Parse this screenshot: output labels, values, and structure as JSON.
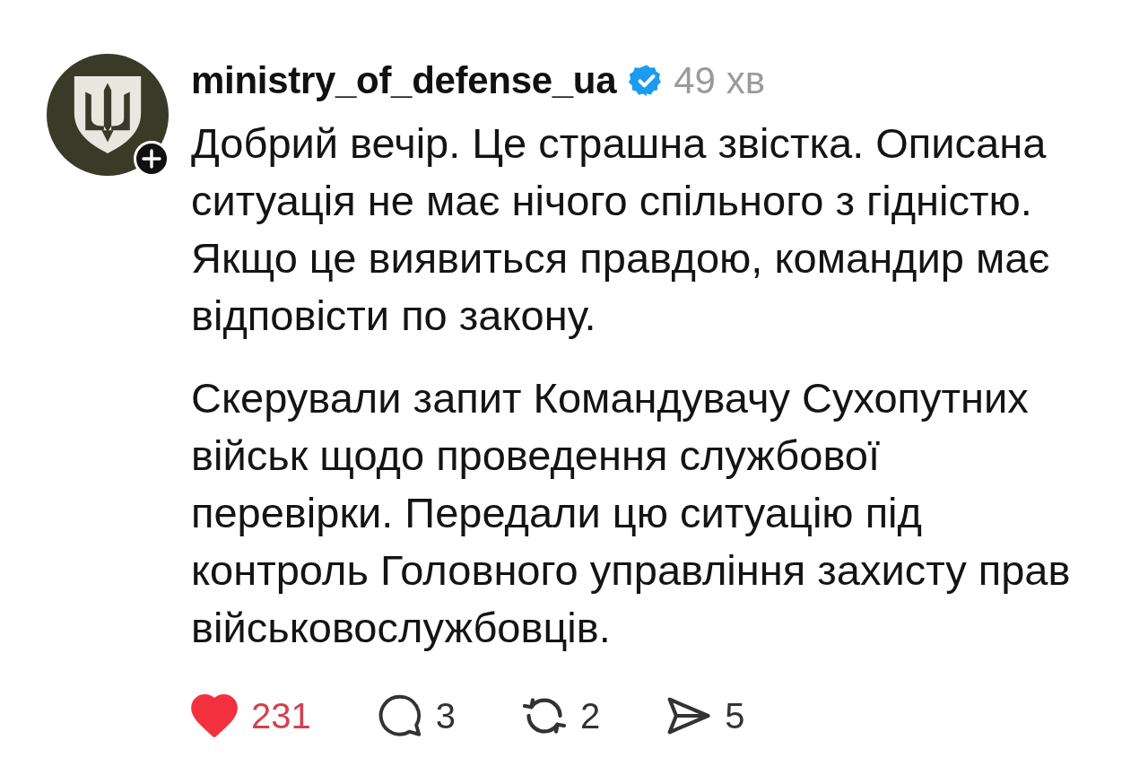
{
  "post": {
    "author": {
      "username": "ministry_of_defense_ua",
      "verified": true,
      "time": "49 хв"
    },
    "paragraphs": [
      "Добрий вечір. Це страшна звістка. Описана ситуація не має нічого спільного з гідністю. Якщо це виявиться правдою, командир має відповісти по закону.",
      "Скерували запит Командувачу Сухопутних військ щодо проведення службової перевірки. Передали цю ситуацію під контроль Головного управління захисту прав військовослужбовців."
    ],
    "actions": [
      {
        "kind": "like",
        "count": "231",
        "on": true
      },
      {
        "kind": "comment",
        "count": "3",
        "on": false
      },
      {
        "kind": "repost",
        "count": "2",
        "on": false
      },
      {
        "kind": "share",
        "count": "5",
        "on": false
      }
    ]
  }
}
